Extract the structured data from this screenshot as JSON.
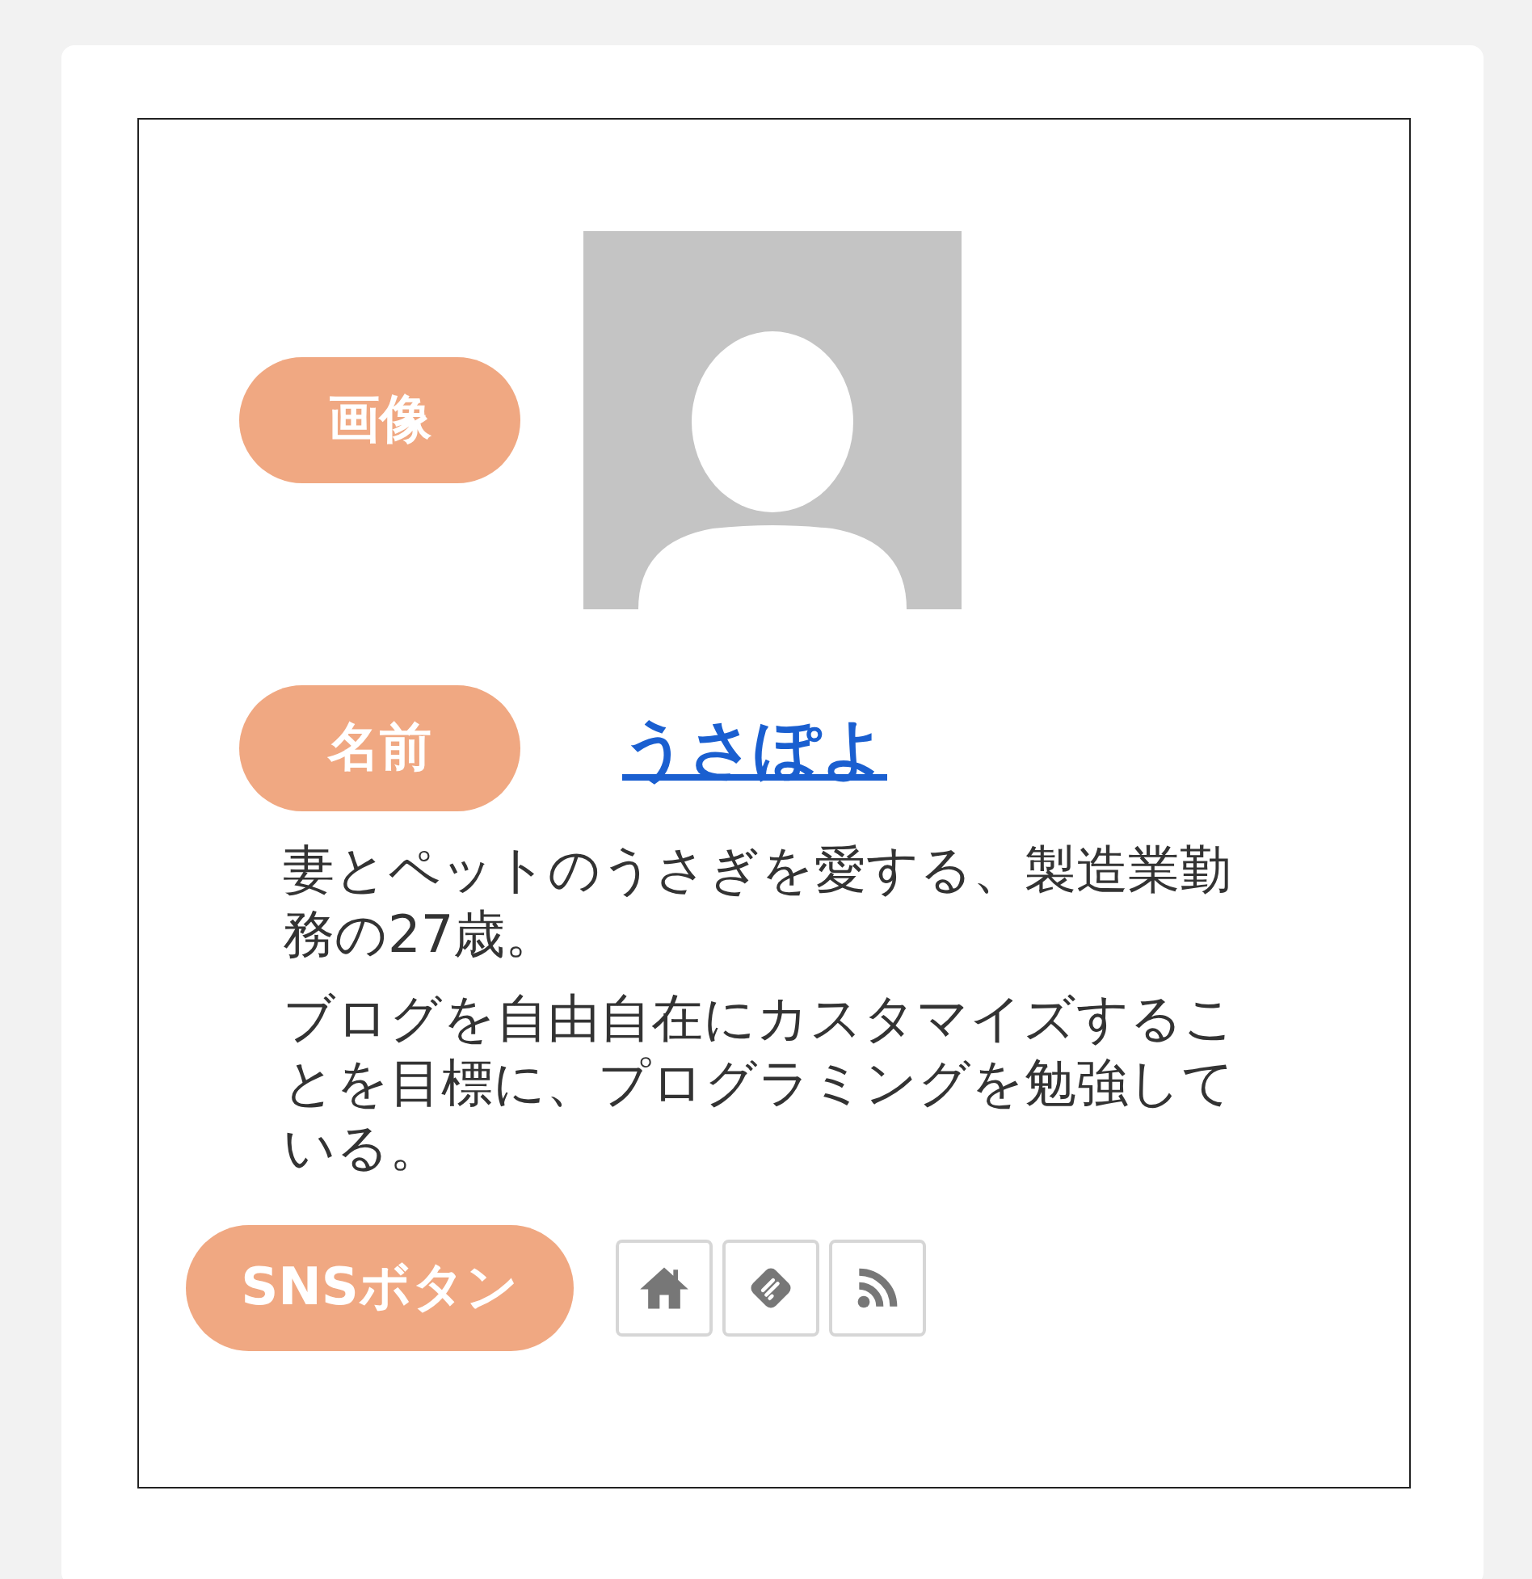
{
  "profile": {
    "image": {
      "label": "画像"
    },
    "name": {
      "label": "名前",
      "text": "うさぽよ"
    },
    "bio": [
      "妻とペットのうさぎを愛する、製造業勤務の27歳。",
      "ブログを自由自在にカスタマイズすることを目標に、プログラミングを勉強している。"
    ],
    "sns": {
      "label": "SNSボタン",
      "buttons": [
        {
          "kind": "home"
        },
        {
          "kind": "feedly"
        },
        {
          "kind": "rss"
        }
      ]
    }
  }
}
